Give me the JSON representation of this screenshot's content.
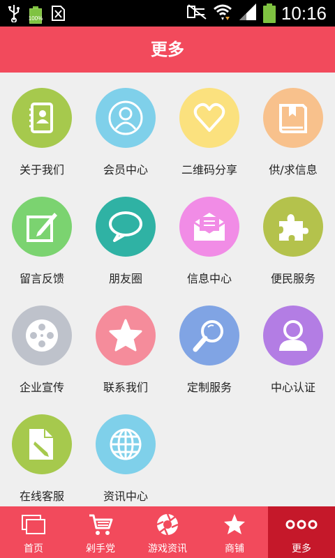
{
  "status_bar": {
    "battery_small_pct": "100%",
    "time": "10:16"
  },
  "header": {
    "title": "更多"
  },
  "grid": [
    {
      "label": "关于我们",
      "icon": "contact-book-icon",
      "color": "#a6c94d"
    },
    {
      "label": "会员中心",
      "icon": "member-person-icon",
      "color": "#7fd0ea"
    },
    {
      "label": "二维码分享",
      "icon": "heart-icon",
      "color": "#fbe17e"
    },
    {
      "label": "供/求信息",
      "icon": "book-icon",
      "color": "#f8c18c"
    },
    {
      "label": "留言反馈",
      "icon": "edit-note-icon",
      "color": "#7bd370"
    },
    {
      "label": "朋友圈",
      "icon": "speech-bubble-icon",
      "color": "#2fb2a4"
    },
    {
      "label": "信息中心",
      "icon": "mail-icon",
      "color": "#f18ce6"
    },
    {
      "label": "便民服务",
      "icon": "puzzle-icon",
      "color": "#b4c24c"
    },
    {
      "label": "企业宣传",
      "icon": "film-reel-icon",
      "color": "#bec2cb"
    },
    {
      "label": "联系我们",
      "icon": "star-icon",
      "color": "#f58c9b"
    },
    {
      "label": "定制服务",
      "icon": "magnifier-icon",
      "color": "#80a4e4"
    },
    {
      "label": "中心认证",
      "icon": "user-avatar-icon",
      "color": "#b37de4"
    },
    {
      "label": "在线客服",
      "icon": "document-pen-icon",
      "color": "#a6c94d"
    },
    {
      "label": "资讯中心",
      "icon": "globe-icon",
      "color": "#7fd0ea"
    }
  ],
  "bottom_nav": [
    {
      "label": "首页",
      "icon": "pages-icon"
    },
    {
      "label": "剁手党",
      "icon": "cart-icon"
    },
    {
      "label": "游戏资讯",
      "icon": "aperture-icon"
    },
    {
      "label": "商铺",
      "icon": "star-shop-icon"
    },
    {
      "label": "更多",
      "icon": "more-dots-icon"
    }
  ],
  "colors": {
    "accent": "#f24a5c",
    "active_tab": "#c5182a",
    "background": "#efefef"
  }
}
